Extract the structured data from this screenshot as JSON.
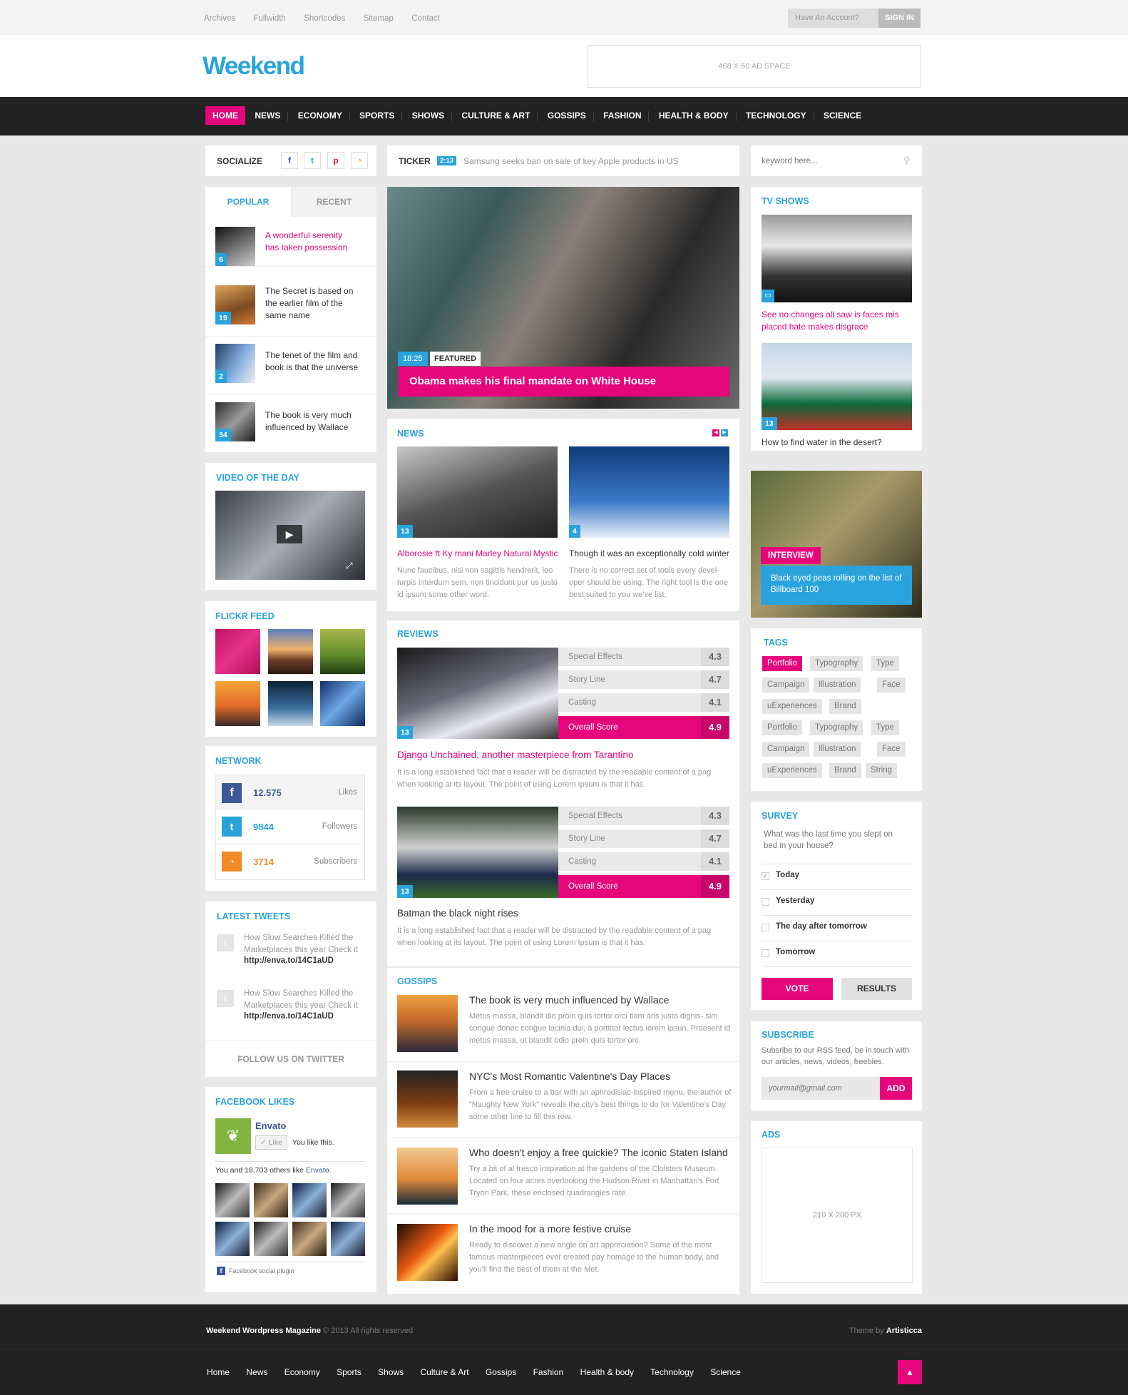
{
  "topbar": {
    "links": [
      "Archives",
      "Fullwidth",
      "Shortcodes",
      "Sitemap",
      "Contact"
    ],
    "account_label": "Have An Account?",
    "signin_label": "SIGN IN"
  },
  "header": {
    "logo": "Weekend",
    "ad_label": "468 X 60 AD SPACE"
  },
  "nav": {
    "items": [
      "HOME",
      "NEWS",
      "ECONOMY",
      "SPORTS",
      "SHOWS",
      "CULTURE & ART",
      "GOSSIPS",
      "FASHION",
      "HEALTH & BODY",
      "TECHNOLOGY",
      "SCIENCE"
    ]
  },
  "colors": {
    "accent": "#e6067c",
    "blue": "#2aa3dc",
    "dark": "#222222"
  },
  "socialize": {
    "title": "SOCIALIZE",
    "icons": [
      "facebook-icon",
      "twitter-icon",
      "pinterest-icon",
      "rss-icon"
    ]
  },
  "ticker": {
    "label": "TICKER",
    "time": "2:13",
    "text": "Samsung seeks ban on sale of key Apple products in US"
  },
  "search": {
    "placeholder": "keyword here..."
  },
  "tabs": {
    "popular": "POPULAR",
    "recent": "RECENT",
    "items": [
      {
        "count": "6",
        "text": "A wonderful serenity has taken possession"
      },
      {
        "count": "19",
        "text": "The Secret is based on the earlier film of the same name"
      },
      {
        "count": "2",
        "text": "The tenet of the film and book is that the universe"
      },
      {
        "count": "34",
        "text": "The book is very much influenced by Wallace"
      }
    ]
  },
  "featured": {
    "time": "18:25",
    "label": "FEATURED",
    "title": "Obama makes his final mandate on White House"
  },
  "news": {
    "title": "NEWS",
    "items": [
      {
        "count": "13",
        "title": "Alborosie ft Ky mani Marley Natural Mystic",
        "text": "Nunc faucibus, nisi non sagittis hendrerit, leo turpis interdum sem, non tincidunt pur us justo id ipsum some other word."
      },
      {
        "count": "4",
        "title": "Though it was an exceptionally cold winter",
        "text": "There is no correct set of tools every devel- oper should be using. The right tool is the one best suited to you we've list."
      }
    ]
  },
  "reviews": {
    "title": "REVIEWS",
    "items": [
      {
        "count": "13",
        "title": "Django Unchained, another masterpiece from Tarantino",
        "text": "It is a long established fact that a reader will be distracted by the readable content of a pag  when looking at its layout. The point of using Lorem Ipsum is that it has.",
        "rows": [
          {
            "label": "Special Effects",
            "value": "4.3"
          },
          {
            "label": "Story Line",
            "value": "4.7"
          },
          {
            "label": "Casting",
            "value": "4.1"
          }
        ],
        "overall": {
          "label": "Overall Score",
          "value": "4.9"
        }
      },
      {
        "count": "13",
        "title": "Batman the black night rises",
        "text": "It is a long established fact that a reader will be distracted by the readable content of a pag  when looking at its layout. The point of using Lorem Ipsum is that it has.",
        "rows": [
          {
            "label": "Special Effects",
            "value": "4.3"
          },
          {
            "label": "Story Line",
            "value": "4.7"
          },
          {
            "label": "Casting",
            "value": "4.1"
          }
        ],
        "overall": {
          "label": "Overall Score",
          "value": "4.9"
        }
      }
    ]
  },
  "gossips": {
    "title": "GOSSIPS",
    "items": [
      {
        "title": "The book is very much influenced by Wallace",
        "text": "Metus massa, blandit dio proin quis tortor orci tiam aris justo dignis- sim congue donec congue lacinia dui, a porttitor lectus lorem ipsun. Praesent id metus massa, ut blandit odio proin quis tortor orc."
      },
      {
        "title": "NYC's Most Romantic Valentine's Day Places",
        "text": "From a free cruise to a bar with an aphrodisiac-inspired menu, the author of “Naughty New York” reveals the city's best things to do for Valentine's Day some other line to fill this row."
      },
      {
        "title": "Who doesn't enjoy a free quickie? The iconic Staten Island",
        "text": "Try a bit of al fresco inspiration at the gardens of the Cloisters Museum. Located on four acres overlooking the Hudson River in Manhattan's Fort Tryon Park, these enclosed quadrangles rate."
      },
      {
        "title": "In the mood for a more festive cruise",
        "text": "Ready to discover a new angle on art appreciation? Some of the most famous masterpieces ever created pay homage to the human body, and you'll find the best of them at the Met."
      }
    ]
  },
  "video": {
    "title": "VIDEO OF THE DAY"
  },
  "flickr": {
    "title": "FLICKR FEED"
  },
  "network": {
    "title": "NETWORK",
    "rows": [
      {
        "count": "12.575",
        "label": "Likes"
      },
      {
        "count": "9844",
        "label": "Followers"
      },
      {
        "count": "3714",
        "label": "Subscribers"
      }
    ]
  },
  "tweets": {
    "title": "LATEST TWEETS",
    "items": [
      {
        "text": "How Slow Searches Killed the Marketplaces this year Check it",
        "link": "http://enva.to/14C1aUD"
      },
      {
        "text": "How Slow Searches Killed the Marketplaces this year Check it",
        "link": "http://enva.to/14C1aUD"
      }
    ],
    "follow": "FOLLOW US ON TWITTER"
  },
  "facebook": {
    "title": "FACEBOOK LIKES",
    "page": "Envato",
    "like": "Like",
    "you_like": "You like this.",
    "others_prefix": "You and 18,703 others like",
    "others_link": "Envato.",
    "plugin": "Facebook social plugin"
  },
  "tvshows": {
    "title": "TV SHOWS",
    "items": [
      {
        "title": "See no changes all saw is faces mis placed hate makes disgrace"
      },
      {
        "count": "13",
        "title": "How to find water in the desert?"
      }
    ]
  },
  "interview": {
    "label": "INTERVIEW",
    "text": "Black eyed peas rolling on the list of Billboard 100"
  },
  "tags": {
    "title": "TAGS",
    "items": [
      "Portfolio",
      "Typography",
      "Type",
      "Campaign",
      "Illustration",
      "Face",
      "uExperiences",
      "Brand",
      "Portfolio",
      "Typography",
      "Type",
      "Campaign",
      "Illustration",
      "Face",
      "uExperiences",
      "Brand",
      "String"
    ]
  },
  "survey": {
    "title": "SURVEY",
    "question": "What was the last time you slept on bed in your house?",
    "options": [
      "Today",
      "Yesterday",
      "The day after tomorrow",
      "Tomorrow"
    ],
    "vote": "VOTE",
    "results": "RESULTS"
  },
  "subscribe": {
    "title": "SUBSCRIBE",
    "text": "Subsribe to our RSS feed, be in touch with our articles, news, videos, freebies.",
    "placeholder": "yourmail@gmail.com",
    "button": "ADD"
  },
  "ads": {
    "title": "ADS",
    "label": "210 X 200 PX"
  },
  "footer": {
    "brand": "Weekend Wordpress Magazine",
    "copy": "© 2013 All rights reserved",
    "theme_prefix": "Theme by",
    "theme_author": "Artisticca",
    "links": [
      "Home",
      "News",
      "Economy",
      "Sports",
      "Shows",
      "Culture & Art",
      "Gossips",
      "Fashion",
      "Health & body",
      "Technology",
      "Science"
    ]
  }
}
